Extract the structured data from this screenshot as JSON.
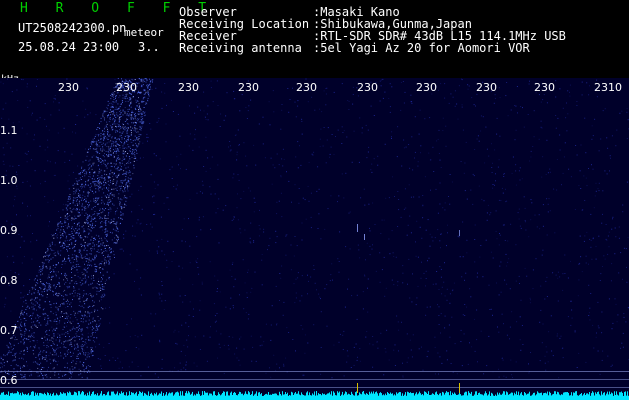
{
  "header": {
    "title": "H R O F F T",
    "filename": "UT2508242300.pn",
    "tag": "meteor",
    "datetime": "25.08.24 23:00",
    "misc": "3..",
    "observer_label": "Observer",
    "observer_value": ":Masaki Kano",
    "location_label": "Receiving Location",
    "location_value": ":Shibukawa,Gunma,Japan",
    "receiver_label": "Receiver",
    "receiver_value": ":RTL-SDR SDR# 43dB L15 114.1MHz USB",
    "antenna_label": "Receiving antenna",
    "antenna_value": ":5el Yagi Az 20 for Aomori VOR"
  },
  "axis": {
    "y_unit": "kHz",
    "y_ticks": [
      "1.1",
      "1.0",
      "0.9",
      "0.8",
      "0.7",
      "0.6"
    ],
    "x_ticks": [
      "230",
      "230",
      "230",
      "230",
      "230",
      "230",
      "230",
      "230",
      "230",
      "2310"
    ]
  },
  "colors": {
    "background": "#000000",
    "spectrum_bg": "#00002a",
    "noise": "#3a4cff",
    "title_green": "#00d000",
    "baseline_cyan": "#00e5ff",
    "marker_yellow": "#d8c000"
  }
}
